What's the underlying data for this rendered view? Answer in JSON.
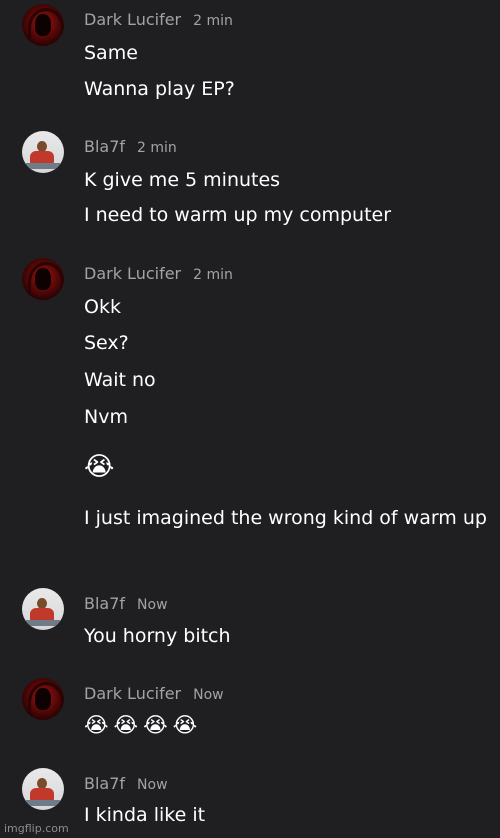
{
  "messages": [
    {
      "author": "Dark Lucifer",
      "time": "2 min",
      "avatar": "dark-lucifer-avatar",
      "lines": [
        "Same",
        "Wanna play EP?"
      ]
    },
    {
      "author": "Bla7f",
      "time": "2 min",
      "avatar": "bla7f-avatar",
      "lines": [
        "K give me 5 minutes",
        "I need to warm up my computer"
      ]
    },
    {
      "author": "Dark Lucifer",
      "time": "2 min",
      "avatar": "dark-lucifer-avatar",
      "lines": [
        "Okk",
        "Sex?",
        "Wait no",
        "Nvm",
        "😭",
        "I just imagined the wrong kind of warm up"
      ]
    },
    {
      "author": "Bla7f",
      "time": "Now",
      "avatar": "bla7f-avatar",
      "lines": [
        "You horny bitch"
      ]
    },
    {
      "author": "Dark Lucifer",
      "time": "Now",
      "avatar": "dark-lucifer-avatar",
      "lines": [
        "😭😭😭😭"
      ]
    },
    {
      "author": "Bla7f",
      "time": "Now",
      "avatar": "bla7f-avatar",
      "lines": [
        "I kinda like it"
      ]
    }
  ],
  "watermark": "imgflip.com",
  "colors": {
    "background": "#1f1f22",
    "meta_text": "#a3a3a6",
    "message_text": "#ffffff"
  }
}
